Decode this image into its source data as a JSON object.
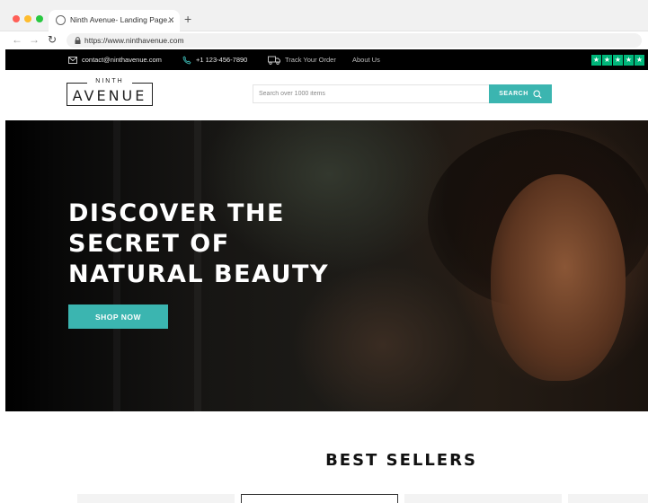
{
  "browser": {
    "tab_title": "Ninth Avenue- Landing Page...",
    "tab_close": "×",
    "new_tab": "+",
    "back": "←",
    "forward": "→",
    "reload": "↻",
    "url": "https://www.ninthavenue.com"
  },
  "topbar": {
    "email": "contact@ninthavenue.com",
    "phone": "+1 123-456-7890",
    "track": "Track Your Order",
    "about": "About Us",
    "trustpilot_stars": [
      "★",
      "★",
      "★",
      "★",
      "★"
    ],
    "accent_green": "#00b67a"
  },
  "header": {
    "logo_small": "NINTH",
    "logo_big": "AVENUE",
    "search_placeholder": "Search over 1000 items",
    "search_button": "SEARCH"
  },
  "hero": {
    "headline_lines": [
      "DISCOVER THE",
      "SECRET OF",
      "NATURAL BEAUTY"
    ],
    "cta": "SHOP NOW"
  },
  "sections": {
    "best_sellers_title": "BEST SELLERS"
  },
  "colors": {
    "brand_teal": "#3bb5b0",
    "topbar_bg": "#000000"
  }
}
